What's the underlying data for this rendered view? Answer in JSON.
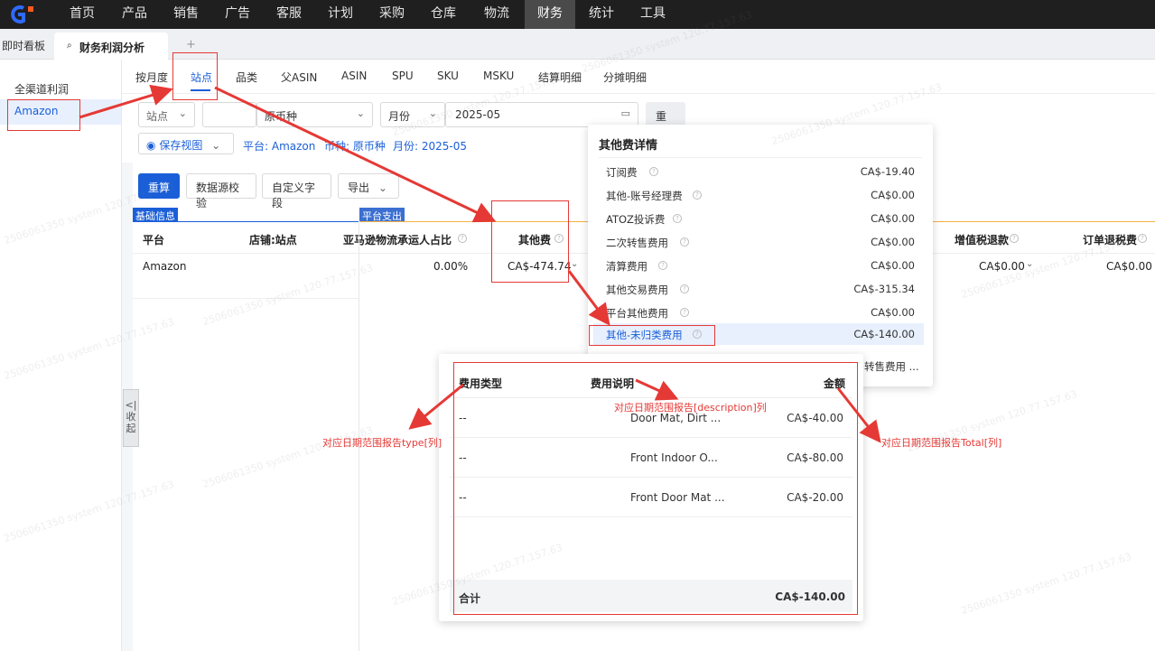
{
  "nav": {
    "items": [
      "首页",
      "产品",
      "销售",
      "广告",
      "客服",
      "计划",
      "采购",
      "仓库",
      "物流",
      "财务",
      "统计",
      "工具"
    ],
    "active": "财务"
  },
  "tabs": {
    "dashboard": "即时看板",
    "active": "财务利润分析",
    "add": "+"
  },
  "sidebar": {
    "items": [
      "全渠道利润",
      "Amazon"
    ]
  },
  "subtabs": [
    "按月度",
    "站点",
    "品类",
    "父ASIN",
    "ASIN",
    "SPU",
    "SKU",
    "MSKU",
    "结算明细",
    "分摊明细"
  ],
  "filters": {
    "site": "站点",
    "currency": "原币种",
    "period_type": "月份",
    "month": "2025-05",
    "reset": "重置",
    "save_view": "保存视图",
    "chip_platform": "平台: Amazon",
    "chip_currency": "币种: 原币种",
    "chip_month": "月份: 2025-05"
  },
  "toolbar": {
    "recalc": "重算",
    "verify": "数据源校验",
    "custom_fields": "自定义字段",
    "export": "导出"
  },
  "table": {
    "group_basic": "基础信息",
    "group_platform": "平台支出",
    "headers": {
      "platform": "平台",
      "store": "店铺:站点",
      "carrier": "亚马逊物流承运人占比",
      "other_fee": "其他费",
      "vat_refund": "增值税退款",
      "order_tax_refund": "订单退税费"
    },
    "row": {
      "platform": "Amazon",
      "carrier": "0.00%",
      "other_fee": "CA$-474.74",
      "vat_refund": "CA$0.00",
      "order_tax_refund": "CA$0.00"
    }
  },
  "collapse": "收起",
  "popover": {
    "title": "其他费详情",
    "rows": [
      {
        "label": "订阅费",
        "value": "CA$-19.40"
      },
      {
        "label": "其他-账号经理费",
        "value": "CA$0.00"
      },
      {
        "label": "ATOZ投诉费",
        "value": "CA$0.00"
      },
      {
        "label": "二次转售费用",
        "value": "CA$0.00"
      },
      {
        "label": "清算费用",
        "value": "CA$0.00"
      },
      {
        "label": "其他交易费用",
        "value": "CA$-315.34"
      },
      {
        "label": "平台其他费用",
        "value": "CA$0.00"
      },
      {
        "label": "其他-未归类费用",
        "value": "CA$-140.00"
      }
    ],
    "more": "转售费用 ..."
  },
  "detail": {
    "headers": {
      "type": "费用类型",
      "desc": "费用说明",
      "amount": "金额"
    },
    "rows": [
      {
        "type": "--",
        "desc": "Door Mat, Dirt ...",
        "amount": "CA$-40.00"
      },
      {
        "type": "--",
        "desc": "Front Indoor O...",
        "amount": "CA$-80.00"
      },
      {
        "type": "--",
        "desc": "Front Door Mat ...",
        "amount": "CA$-20.00"
      }
    ],
    "total_label": "合计",
    "total_value": "CA$-140.00"
  },
  "annotations": {
    "type": "对应日期范围报告type[列]",
    "description": "对应日期范围报告[description]列",
    "total": "对应日期范围报告Total[列]"
  },
  "watermark": "2506061350 system 120.77.157.63",
  "colors": {
    "accent": "#1a5fd8",
    "annotation": "#e53935",
    "topbar": "#1f1f1f"
  }
}
